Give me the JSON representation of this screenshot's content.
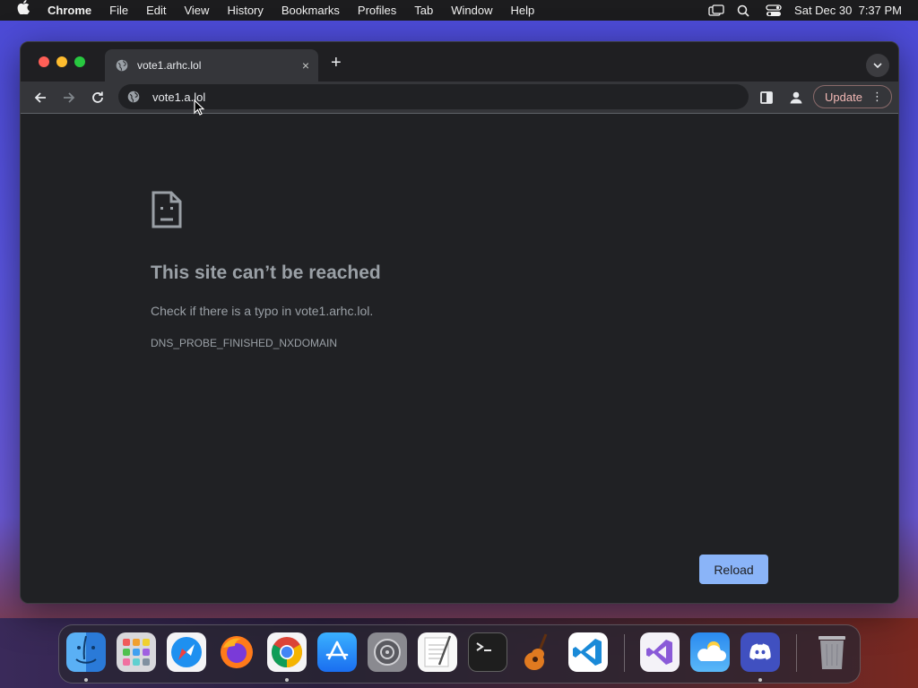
{
  "menubar": {
    "app_name": "Chrome",
    "items": [
      "File",
      "Edit",
      "View",
      "History",
      "Bookmarks",
      "Profiles",
      "Tab",
      "Window",
      "Help"
    ],
    "datetime": "Sat Dec 30  7:37 PM"
  },
  "browser": {
    "tab": {
      "title": "vote1.arhc.lol",
      "close_glyph": "×"
    },
    "new_tab_glyph": "+",
    "omnibox": {
      "value": "vote1.a.lol"
    },
    "update_label": "Update",
    "menu_glyph": "⋮"
  },
  "error_page": {
    "title": "This site can’t be reached",
    "subtitle": "Check if there is a typo in vote1.arhc.lol.",
    "error_code": "DNS_PROBE_FINISHED_NXDOMAIN",
    "reload_label": "Reload"
  },
  "colors": {
    "accent_blue": "#8ab4f8",
    "page_bg": "#202124",
    "toolbar_bg": "#35363a",
    "update_text": "#f2b8b5"
  },
  "dock": {
    "apps": [
      "finder-icon",
      "launchpad-icon",
      "safari-icon",
      "firefox-icon",
      "chrome-icon",
      "app-store-icon",
      "system-settings-icon",
      "textedit-icon",
      "terminal-icon",
      "garageband-icon",
      "vscode-icon",
      "visual-studio-icon",
      "weather-icon",
      "discord-icon",
      "trash-icon"
    ]
  }
}
